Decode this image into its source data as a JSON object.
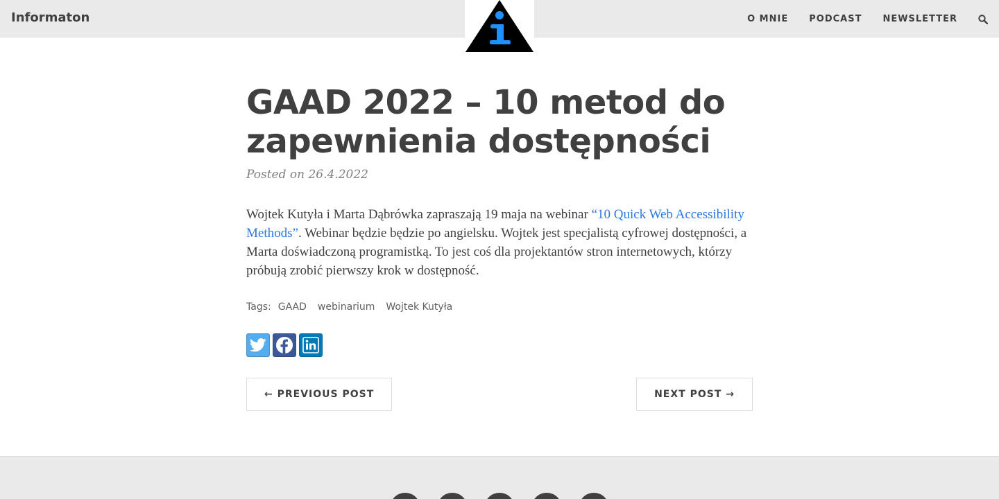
{
  "navbar": {
    "brand": "Informaton",
    "logo_icon": "info-triangle-logo",
    "links": [
      "O MNIE",
      "PODCAST",
      "NEWSLETTER"
    ],
    "search_icon": "search-icon"
  },
  "post": {
    "title": "GAAD 2022 – 10 metod do zapewnienia dostępności",
    "meta": "Posted on 26.4.2022",
    "body_pre": "Wojtek Kutyła i Marta Dąbrówka zapraszają 19 maja na webinar ",
    "body_link": "“10 Quick Web Accessibility Methods”",
    "body_post": ". Webinar będzie będzie po angielsku. Wojtek jest specjalistą cyfrowej dostępności, a Marta doświadczoną programistką. To jest coś dla projektantów stron internetowych, którzy próbują zrobić pierwszy krok w dostępność.",
    "tags_label": "Tags:",
    "tags": [
      "GAAD",
      "webinarium",
      "Wojtek Kutyła"
    ]
  },
  "share": {
    "twitter_color": "#55acee",
    "facebook_color": "#3b5998",
    "linkedin_color": "#007bb5"
  },
  "pager": {
    "prev": "← Previous Post",
    "next": "Next Post →"
  },
  "colors": {
    "link": "#2a7ae2",
    "nav_bg": "#eaeaea",
    "text": "#404040",
    "logo_blue": "#1e90ff"
  }
}
